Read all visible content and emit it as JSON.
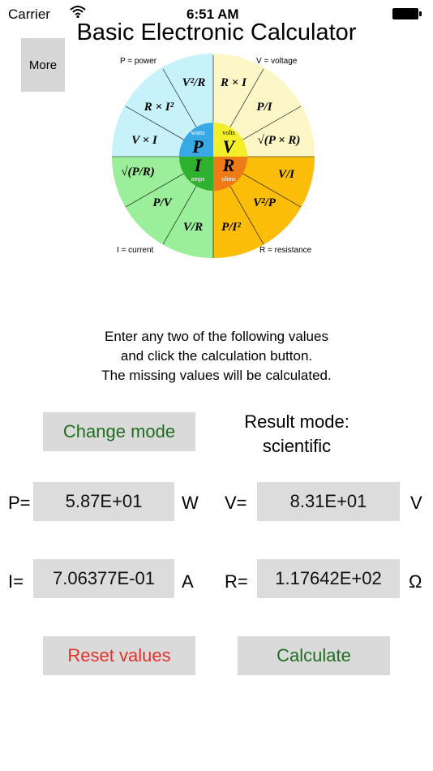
{
  "status_bar": {
    "carrier": "Carrier",
    "time": "6:51 AM"
  },
  "app": {
    "title": "Basic Electronic Calculator",
    "more_label": "More"
  },
  "wheel": {
    "corner_labels": {
      "power": "P = power",
      "voltage": "V = voltage",
      "current": "I = current",
      "resistance": "R = resistance"
    },
    "center": {
      "p": {
        "symbol": "P",
        "unit": "watts"
      },
      "v": {
        "symbol": "V",
        "unit": "volts"
      },
      "i": {
        "symbol": "I",
        "unit": "amps"
      },
      "r": {
        "symbol": "R",
        "unit": "ohms"
      }
    },
    "formulas": {
      "p1": "V²/R",
      "p2": "R × I²",
      "p3": "V × I",
      "v1": "R × I",
      "v2": "P/I",
      "v3": "√(P × R)",
      "r1": "V/I",
      "r2": "V²/P",
      "r3": "P/I²",
      "i1": "V/R",
      "i2": "P/V",
      "i3": "√(P/R)"
    },
    "colors": {
      "power": "#c8f2fa",
      "voltage": "#fdf7c8",
      "current": "#9bef9b",
      "resistance": "#fcbd08",
      "power_center": "#39a9e6",
      "voltage_center": "#f2ef2a",
      "current_center": "#2fb12f",
      "resistance_center": "#ee7b16"
    }
  },
  "instructions": [
    "Enter any two of the following values",
    "and click the calculation button.",
    "The missing values will be calculated."
  ],
  "mode": {
    "change_label": "Change mode",
    "result_line1": "Result mode:",
    "result_line2": "scientific"
  },
  "fields": {
    "p": {
      "label": "P=",
      "value": "5.87E+01",
      "unit": "W"
    },
    "v": {
      "label": "V=",
      "value": "8.31E+01",
      "unit": "V"
    },
    "i": {
      "label": "I=",
      "value": "7.06377E-01",
      "unit": "A"
    },
    "r": {
      "label": "R=",
      "value": "1.17642E+02",
      "unit": "Ω"
    }
  },
  "actions": {
    "reset_label": "Reset values",
    "calculate_label": "Calculate"
  },
  "theme": {
    "green_text": "#1f6e1f",
    "red_text": "#e53228",
    "button_bg": "#dadada"
  }
}
